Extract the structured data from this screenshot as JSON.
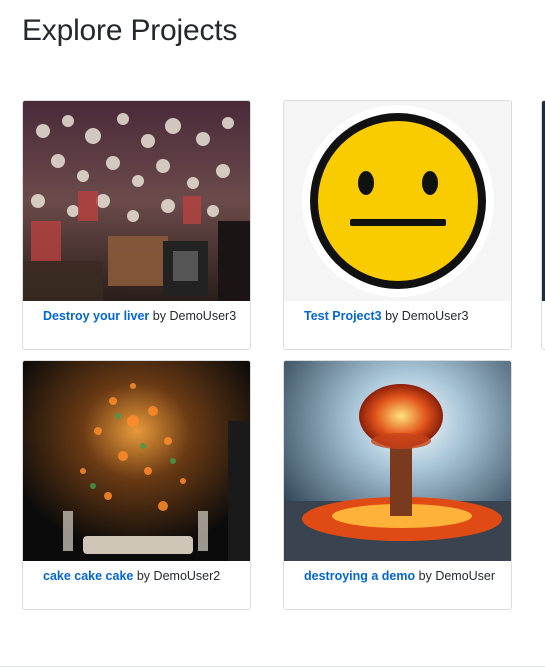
{
  "page": {
    "title": "Explore Projects"
  },
  "projects": [
    {
      "name": "Destroy your liver",
      "by": "by",
      "author": "DemoUser3",
      "image": "party-crowd-photo"
    },
    {
      "name": "Test Project3",
      "by": "by",
      "author": "DemoUser3",
      "image": "neutral-face-emoji"
    },
    {
      "name": "cake cake cake",
      "by": "by",
      "author": "DemoUser2",
      "image": "exploding-cake-photo"
    },
    {
      "name": "destroying a demo",
      "by": "by",
      "author": "DemoUser",
      "image": "mushroom-cloud-explosion"
    }
  ],
  "colors": {
    "link": "#0366d6",
    "text": "#24292e",
    "border": "#dcdcdc"
  }
}
